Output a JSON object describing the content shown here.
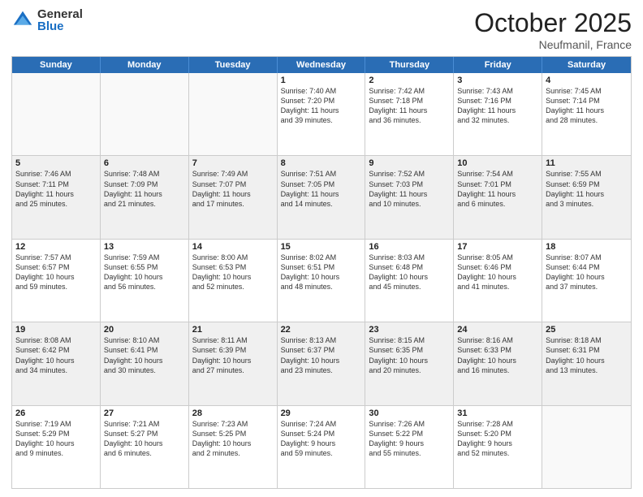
{
  "logo": {
    "general": "General",
    "blue": "Blue"
  },
  "title": "October 2025",
  "location": "Neufmanil, France",
  "days": [
    "Sunday",
    "Monday",
    "Tuesday",
    "Wednesday",
    "Thursday",
    "Friday",
    "Saturday"
  ],
  "weeks": [
    [
      {
        "day": "",
        "text": ""
      },
      {
        "day": "",
        "text": ""
      },
      {
        "day": "",
        "text": ""
      },
      {
        "day": "1",
        "text": "Sunrise: 7:40 AM\nSunset: 7:20 PM\nDaylight: 11 hours\nand 39 minutes."
      },
      {
        "day": "2",
        "text": "Sunrise: 7:42 AM\nSunset: 7:18 PM\nDaylight: 11 hours\nand 36 minutes."
      },
      {
        "day": "3",
        "text": "Sunrise: 7:43 AM\nSunset: 7:16 PM\nDaylight: 11 hours\nand 32 minutes."
      },
      {
        "day": "4",
        "text": "Sunrise: 7:45 AM\nSunset: 7:14 PM\nDaylight: 11 hours\nand 28 minutes."
      }
    ],
    [
      {
        "day": "5",
        "text": "Sunrise: 7:46 AM\nSunset: 7:11 PM\nDaylight: 11 hours\nand 25 minutes."
      },
      {
        "day": "6",
        "text": "Sunrise: 7:48 AM\nSunset: 7:09 PM\nDaylight: 11 hours\nand 21 minutes."
      },
      {
        "day": "7",
        "text": "Sunrise: 7:49 AM\nSunset: 7:07 PM\nDaylight: 11 hours\nand 17 minutes."
      },
      {
        "day": "8",
        "text": "Sunrise: 7:51 AM\nSunset: 7:05 PM\nDaylight: 11 hours\nand 14 minutes."
      },
      {
        "day": "9",
        "text": "Sunrise: 7:52 AM\nSunset: 7:03 PM\nDaylight: 11 hours\nand 10 minutes."
      },
      {
        "day": "10",
        "text": "Sunrise: 7:54 AM\nSunset: 7:01 PM\nDaylight: 11 hours\nand 6 minutes."
      },
      {
        "day": "11",
        "text": "Sunrise: 7:55 AM\nSunset: 6:59 PM\nDaylight: 11 hours\nand 3 minutes."
      }
    ],
    [
      {
        "day": "12",
        "text": "Sunrise: 7:57 AM\nSunset: 6:57 PM\nDaylight: 10 hours\nand 59 minutes."
      },
      {
        "day": "13",
        "text": "Sunrise: 7:59 AM\nSunset: 6:55 PM\nDaylight: 10 hours\nand 56 minutes."
      },
      {
        "day": "14",
        "text": "Sunrise: 8:00 AM\nSunset: 6:53 PM\nDaylight: 10 hours\nand 52 minutes."
      },
      {
        "day": "15",
        "text": "Sunrise: 8:02 AM\nSunset: 6:51 PM\nDaylight: 10 hours\nand 48 minutes."
      },
      {
        "day": "16",
        "text": "Sunrise: 8:03 AM\nSunset: 6:48 PM\nDaylight: 10 hours\nand 45 minutes."
      },
      {
        "day": "17",
        "text": "Sunrise: 8:05 AM\nSunset: 6:46 PM\nDaylight: 10 hours\nand 41 minutes."
      },
      {
        "day": "18",
        "text": "Sunrise: 8:07 AM\nSunset: 6:44 PM\nDaylight: 10 hours\nand 37 minutes."
      }
    ],
    [
      {
        "day": "19",
        "text": "Sunrise: 8:08 AM\nSunset: 6:42 PM\nDaylight: 10 hours\nand 34 minutes."
      },
      {
        "day": "20",
        "text": "Sunrise: 8:10 AM\nSunset: 6:41 PM\nDaylight: 10 hours\nand 30 minutes."
      },
      {
        "day": "21",
        "text": "Sunrise: 8:11 AM\nSunset: 6:39 PM\nDaylight: 10 hours\nand 27 minutes."
      },
      {
        "day": "22",
        "text": "Sunrise: 8:13 AM\nSunset: 6:37 PM\nDaylight: 10 hours\nand 23 minutes."
      },
      {
        "day": "23",
        "text": "Sunrise: 8:15 AM\nSunset: 6:35 PM\nDaylight: 10 hours\nand 20 minutes."
      },
      {
        "day": "24",
        "text": "Sunrise: 8:16 AM\nSunset: 6:33 PM\nDaylight: 10 hours\nand 16 minutes."
      },
      {
        "day": "25",
        "text": "Sunrise: 8:18 AM\nSunset: 6:31 PM\nDaylight: 10 hours\nand 13 minutes."
      }
    ],
    [
      {
        "day": "26",
        "text": "Sunrise: 7:19 AM\nSunset: 5:29 PM\nDaylight: 10 hours\nand 9 minutes."
      },
      {
        "day": "27",
        "text": "Sunrise: 7:21 AM\nSunset: 5:27 PM\nDaylight: 10 hours\nand 6 minutes."
      },
      {
        "day": "28",
        "text": "Sunrise: 7:23 AM\nSunset: 5:25 PM\nDaylight: 10 hours\nand 2 minutes."
      },
      {
        "day": "29",
        "text": "Sunrise: 7:24 AM\nSunset: 5:24 PM\nDaylight: 9 hours\nand 59 minutes."
      },
      {
        "day": "30",
        "text": "Sunrise: 7:26 AM\nSunset: 5:22 PM\nDaylight: 9 hours\nand 55 minutes."
      },
      {
        "day": "31",
        "text": "Sunrise: 7:28 AM\nSunset: 5:20 PM\nDaylight: 9 hours\nand 52 minutes."
      },
      {
        "day": "",
        "text": ""
      }
    ]
  ]
}
